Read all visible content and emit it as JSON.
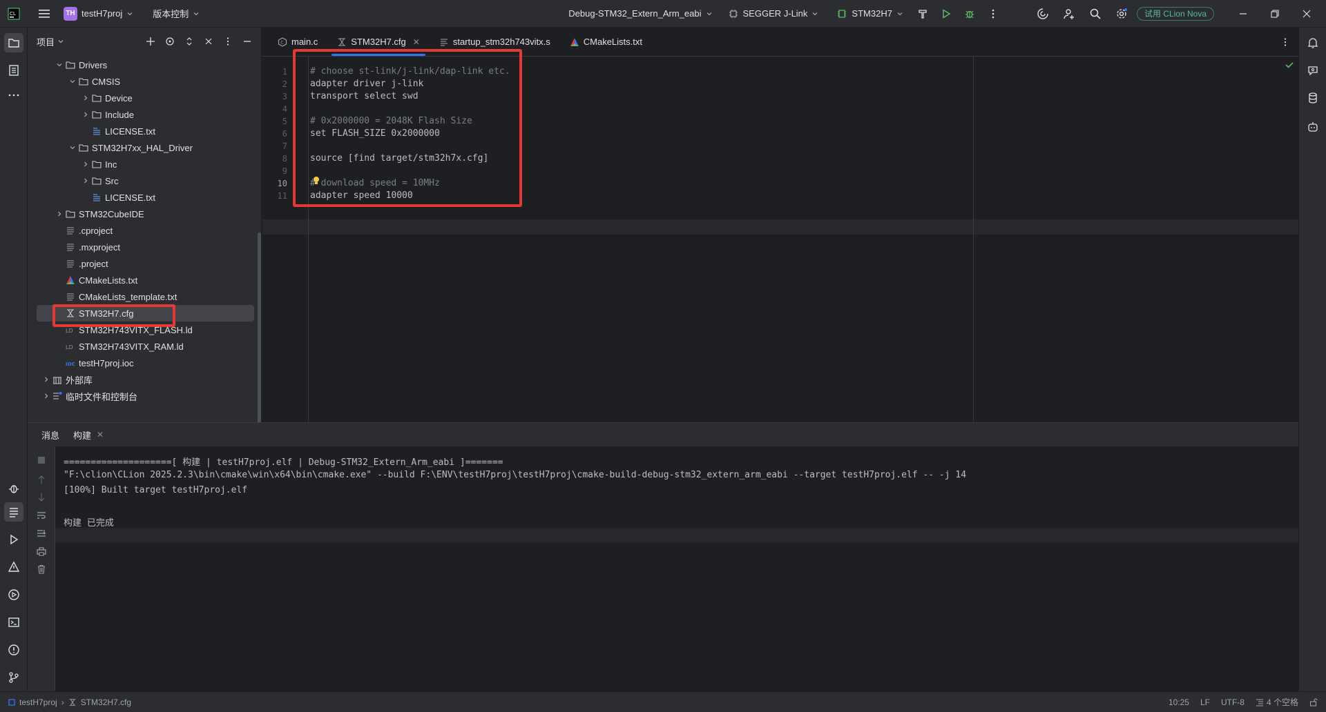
{
  "titlebar": {
    "project_badge": "TH",
    "project_name": "testH7proj",
    "vcs_label": "版本控制",
    "run_config": "Debug-STM32_Extern_Arm_eabi",
    "debugger": "SEGGER J-Link",
    "target": "STM32H7",
    "trial_label": "试用 CLion Nova"
  },
  "project_panel": {
    "title": "项目",
    "tree": [
      {
        "label": "Drivers",
        "kind": "folder",
        "level": 1,
        "expanded": true
      },
      {
        "label": "CMSIS",
        "kind": "folder",
        "level": 2,
        "expanded": true
      },
      {
        "label": "Device",
        "kind": "folder",
        "level": 3,
        "expanded": false
      },
      {
        "label": "Include",
        "kind": "folder",
        "level": 3,
        "expanded": false
      },
      {
        "label": "LICENSE.txt",
        "kind": "license",
        "level": 3
      },
      {
        "label": "STM32H7xx_HAL_Driver",
        "kind": "folder",
        "level": 2,
        "expanded": true
      },
      {
        "label": "Inc",
        "kind": "folder",
        "level": 3,
        "expanded": false
      },
      {
        "label": "Src",
        "kind": "folder",
        "level": 3,
        "expanded": false
      },
      {
        "label": "LICENSE.txt",
        "kind": "license",
        "level": 3
      },
      {
        "label": "STM32CubeIDE",
        "kind": "folder",
        "level": 1,
        "expanded": false
      },
      {
        "label": ".cproject",
        "kind": "text",
        "level": 1
      },
      {
        "label": ".mxproject",
        "kind": "text",
        "level": 1
      },
      {
        "label": ".project",
        "kind": "text",
        "level": 1
      },
      {
        "label": "CMakeLists.txt",
        "kind": "cmake",
        "level": 1
      },
      {
        "label": "CMakeLists_template.txt",
        "kind": "text",
        "level": 1
      },
      {
        "label": "STM32H7.cfg",
        "kind": "cfg",
        "level": 1,
        "selected": true
      },
      {
        "label": "STM32H743VITX_FLASH.ld",
        "kind": "ld",
        "level": 1
      },
      {
        "label": "STM32H743VITX_RAM.ld",
        "kind": "ld",
        "level": 1
      },
      {
        "label": "testH7proj.ioc",
        "kind": "ioc",
        "level": 1
      },
      {
        "label": "外部库",
        "kind": "library",
        "level": 0,
        "expanded": false
      },
      {
        "label": "临时文件和控制台",
        "kind": "scratch",
        "level": 0,
        "expanded": false
      }
    ]
  },
  "editor": {
    "tabs": [
      {
        "label": "main.c",
        "active": false
      },
      {
        "label": "STM32H7.cfg",
        "active": true
      },
      {
        "label": "startup_stm32h743vitx.s",
        "active": false
      },
      {
        "label": "CMakeLists.txt",
        "active": false
      }
    ],
    "current_line": 10,
    "lines": [
      {
        "n": "1",
        "text": "# choose st-link/j-link/dap-link etc.",
        "comment": true
      },
      {
        "n": "2",
        "text": "adapter driver j-link",
        "comment": false
      },
      {
        "n": "3",
        "text": "transport select swd",
        "comment": false
      },
      {
        "n": "4",
        "text": "",
        "comment": false
      },
      {
        "n": "5",
        "text": "# 0x2000000 = 2048K Flash Size",
        "comment": true
      },
      {
        "n": "6",
        "text": "set FLASH_SIZE 0x2000000",
        "comment": false
      },
      {
        "n": "7",
        "text": "",
        "comment": false
      },
      {
        "n": "8",
        "text": "source [find target/stm32h7x.cfg]",
        "comment": false
      },
      {
        "n": "9",
        "text": "",
        "comment": false
      },
      {
        "n": "10",
        "text": "# download speed = 10MHz",
        "comment": true
      },
      {
        "n": "11",
        "text": "adapter speed 10000",
        "comment": false
      }
    ]
  },
  "build_panel": {
    "tabs": [
      {
        "label": "消息",
        "active": false
      },
      {
        "label": "构建",
        "active": true
      }
    ],
    "output": [
      "====================[ 构建 | testH7proj.elf | Debug-STM32_Extern_Arm_eabi ]=======",
      "\"F:\\clion\\CLion 2025.2.3\\bin\\cmake\\win\\x64\\bin\\cmake.exe\" --build F:\\ENV\\testH7proj\\testH7proj\\cmake-build-debug-stm32_extern_arm_eabi --target testH7proj.elf -- -j 14",
      "[100%] Built target testH7proj.elf",
      "",
      "构建 已完成"
    ]
  },
  "statusbar": {
    "project": "testH7proj",
    "file": "STM32H7.cfg",
    "position": "10:25",
    "line_ending": "LF",
    "encoding": "UTF-8",
    "indent": "4 个空格"
  },
  "colors": {
    "accent": "#3574f0",
    "annotation": "#e53935",
    "trial": "#59b89c"
  }
}
